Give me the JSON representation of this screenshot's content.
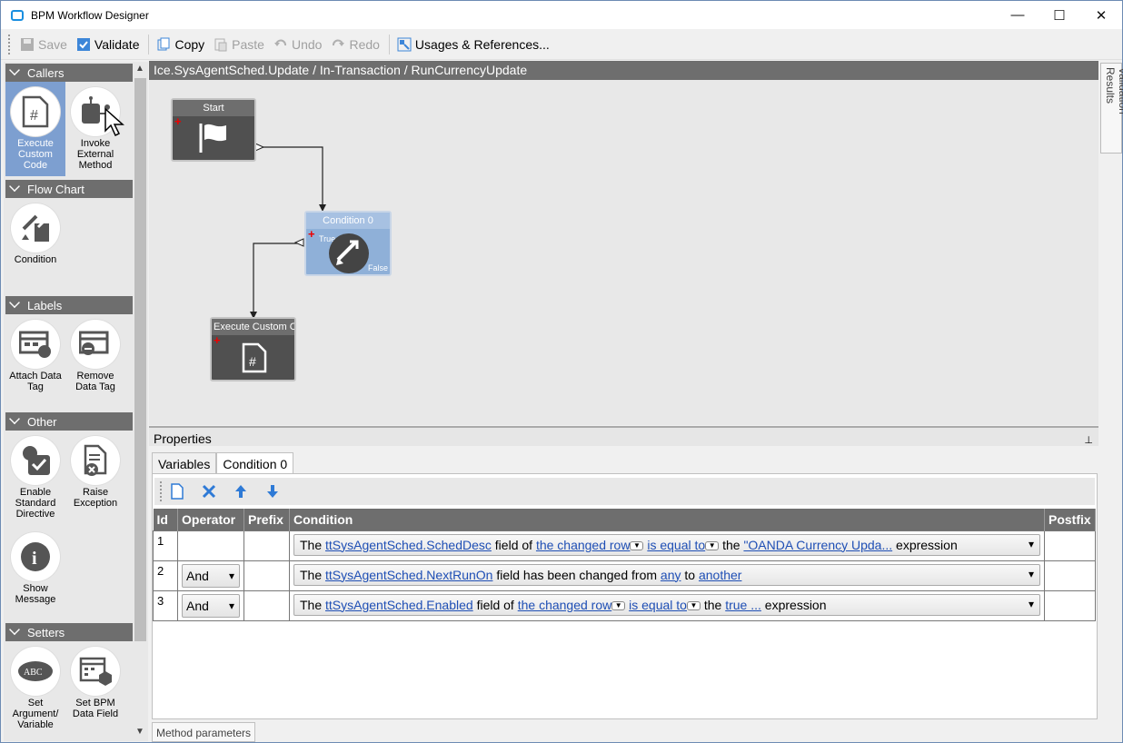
{
  "window": {
    "title": "BPM Workflow Designer",
    "minimize": "—",
    "maximize": "☐",
    "close": "✕"
  },
  "toolbar": {
    "save": "Save",
    "validate": "Validate",
    "copy": "Copy",
    "paste": "Paste",
    "undo": "Undo",
    "redo": "Redo",
    "usages": "Usages & References..."
  },
  "toolbox": {
    "callers": {
      "title": "Callers",
      "items": [
        {
          "label": "Execute Custom Code"
        },
        {
          "label": "Invoke External Method"
        }
      ]
    },
    "flowchart": {
      "title": "Flow Chart",
      "items": [
        {
          "label": "Condition"
        }
      ]
    },
    "labels": {
      "title": "Labels",
      "items": [
        {
          "label": "Attach Data Tag"
        },
        {
          "label": "Remove Data Tag"
        }
      ]
    },
    "other": {
      "title": "Other",
      "items": [
        {
          "label": "Enable Standard Directive"
        },
        {
          "label": "Raise Exception"
        },
        {
          "label": "Show Message"
        }
      ]
    },
    "setters": {
      "title": "Setters",
      "items": [
        {
          "label": "Set Argument/ Variable"
        },
        {
          "label": "Set BPM Data Field"
        }
      ]
    }
  },
  "designer": {
    "breadcrumb": "Ice.SysAgentSched.Update / In-Transaction / RunCurrencyUpdate",
    "validation_tab": "Validation Results",
    "nodes": {
      "start": {
        "title": "Start"
      },
      "condition": {
        "title": "Condition 0",
        "true_label": "True",
        "false_label": "False"
      },
      "custom": {
        "title": "Execute Custom Co"
      }
    }
  },
  "properties": {
    "title": "Properties",
    "pin": "⊥",
    "tabs": [
      "Variables",
      "Condition 0"
    ],
    "columns": [
      "Id",
      "Operator",
      "Prefix",
      "Condition",
      "Postfix"
    ],
    "rows": [
      {
        "id": "1",
        "operator": "",
        "prefix": "",
        "postfix": "",
        "c": {
          "t1": "The ",
          "l1": "ttSysAgentSched.SchedDesc",
          "t2": " field of ",
          "l2": "the changed row",
          "t3": " ",
          "l3": "is equal to",
          "t4": " the ",
          "l4": "\"OANDA Currency Upda...",
          "t5": " expression"
        }
      },
      {
        "id": "2",
        "operator": "And",
        "prefix": "",
        "postfix": "",
        "c": {
          "t1": "The ",
          "l1": "ttSysAgentSched.NextRunOn",
          "t2": " field has been changed from ",
          "l2": "any",
          "t3": " to ",
          "l3": "another"
        }
      },
      {
        "id": "3",
        "operator": "And",
        "prefix": "",
        "postfix": "",
        "c": {
          "t1": "The ",
          "l1": "ttSysAgentSched.Enabled",
          "t2": " field of ",
          "l2": "the changed row",
          "t3": " ",
          "l3": "is equal to",
          "t4": " the ",
          "l4": " true ...",
          "t5": " expression"
        }
      }
    ],
    "method_params": "Method parameters"
  }
}
